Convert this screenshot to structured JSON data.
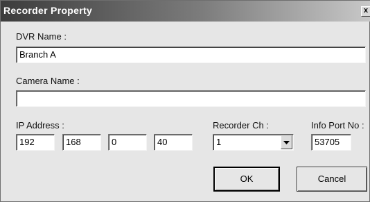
{
  "dialog": {
    "title": "Recorder  Property",
    "close_glyph": "x",
    "close_icon": "close-icon"
  },
  "form": {
    "dvr_name_label": "DVR Name :",
    "dvr_name_value": "Branch A",
    "camera_name_label": "Camera Name :",
    "camera_name_value": "",
    "ip_label": "IP Address :",
    "ip_octets": [
      "192",
      "168",
      "0",
      "40"
    ],
    "recorder_ch_label": "Recorder Ch :",
    "recorder_ch_value": "1",
    "info_port_label": "Info Port No :",
    "info_port_value": "53705"
  },
  "buttons": {
    "ok": "OK",
    "cancel": "Cancel"
  },
  "colors": {
    "dialog_bg": "#e6e6e6",
    "title_bar_start": "#3c3c3c",
    "title_bar_end": "#c8c8c8"
  }
}
